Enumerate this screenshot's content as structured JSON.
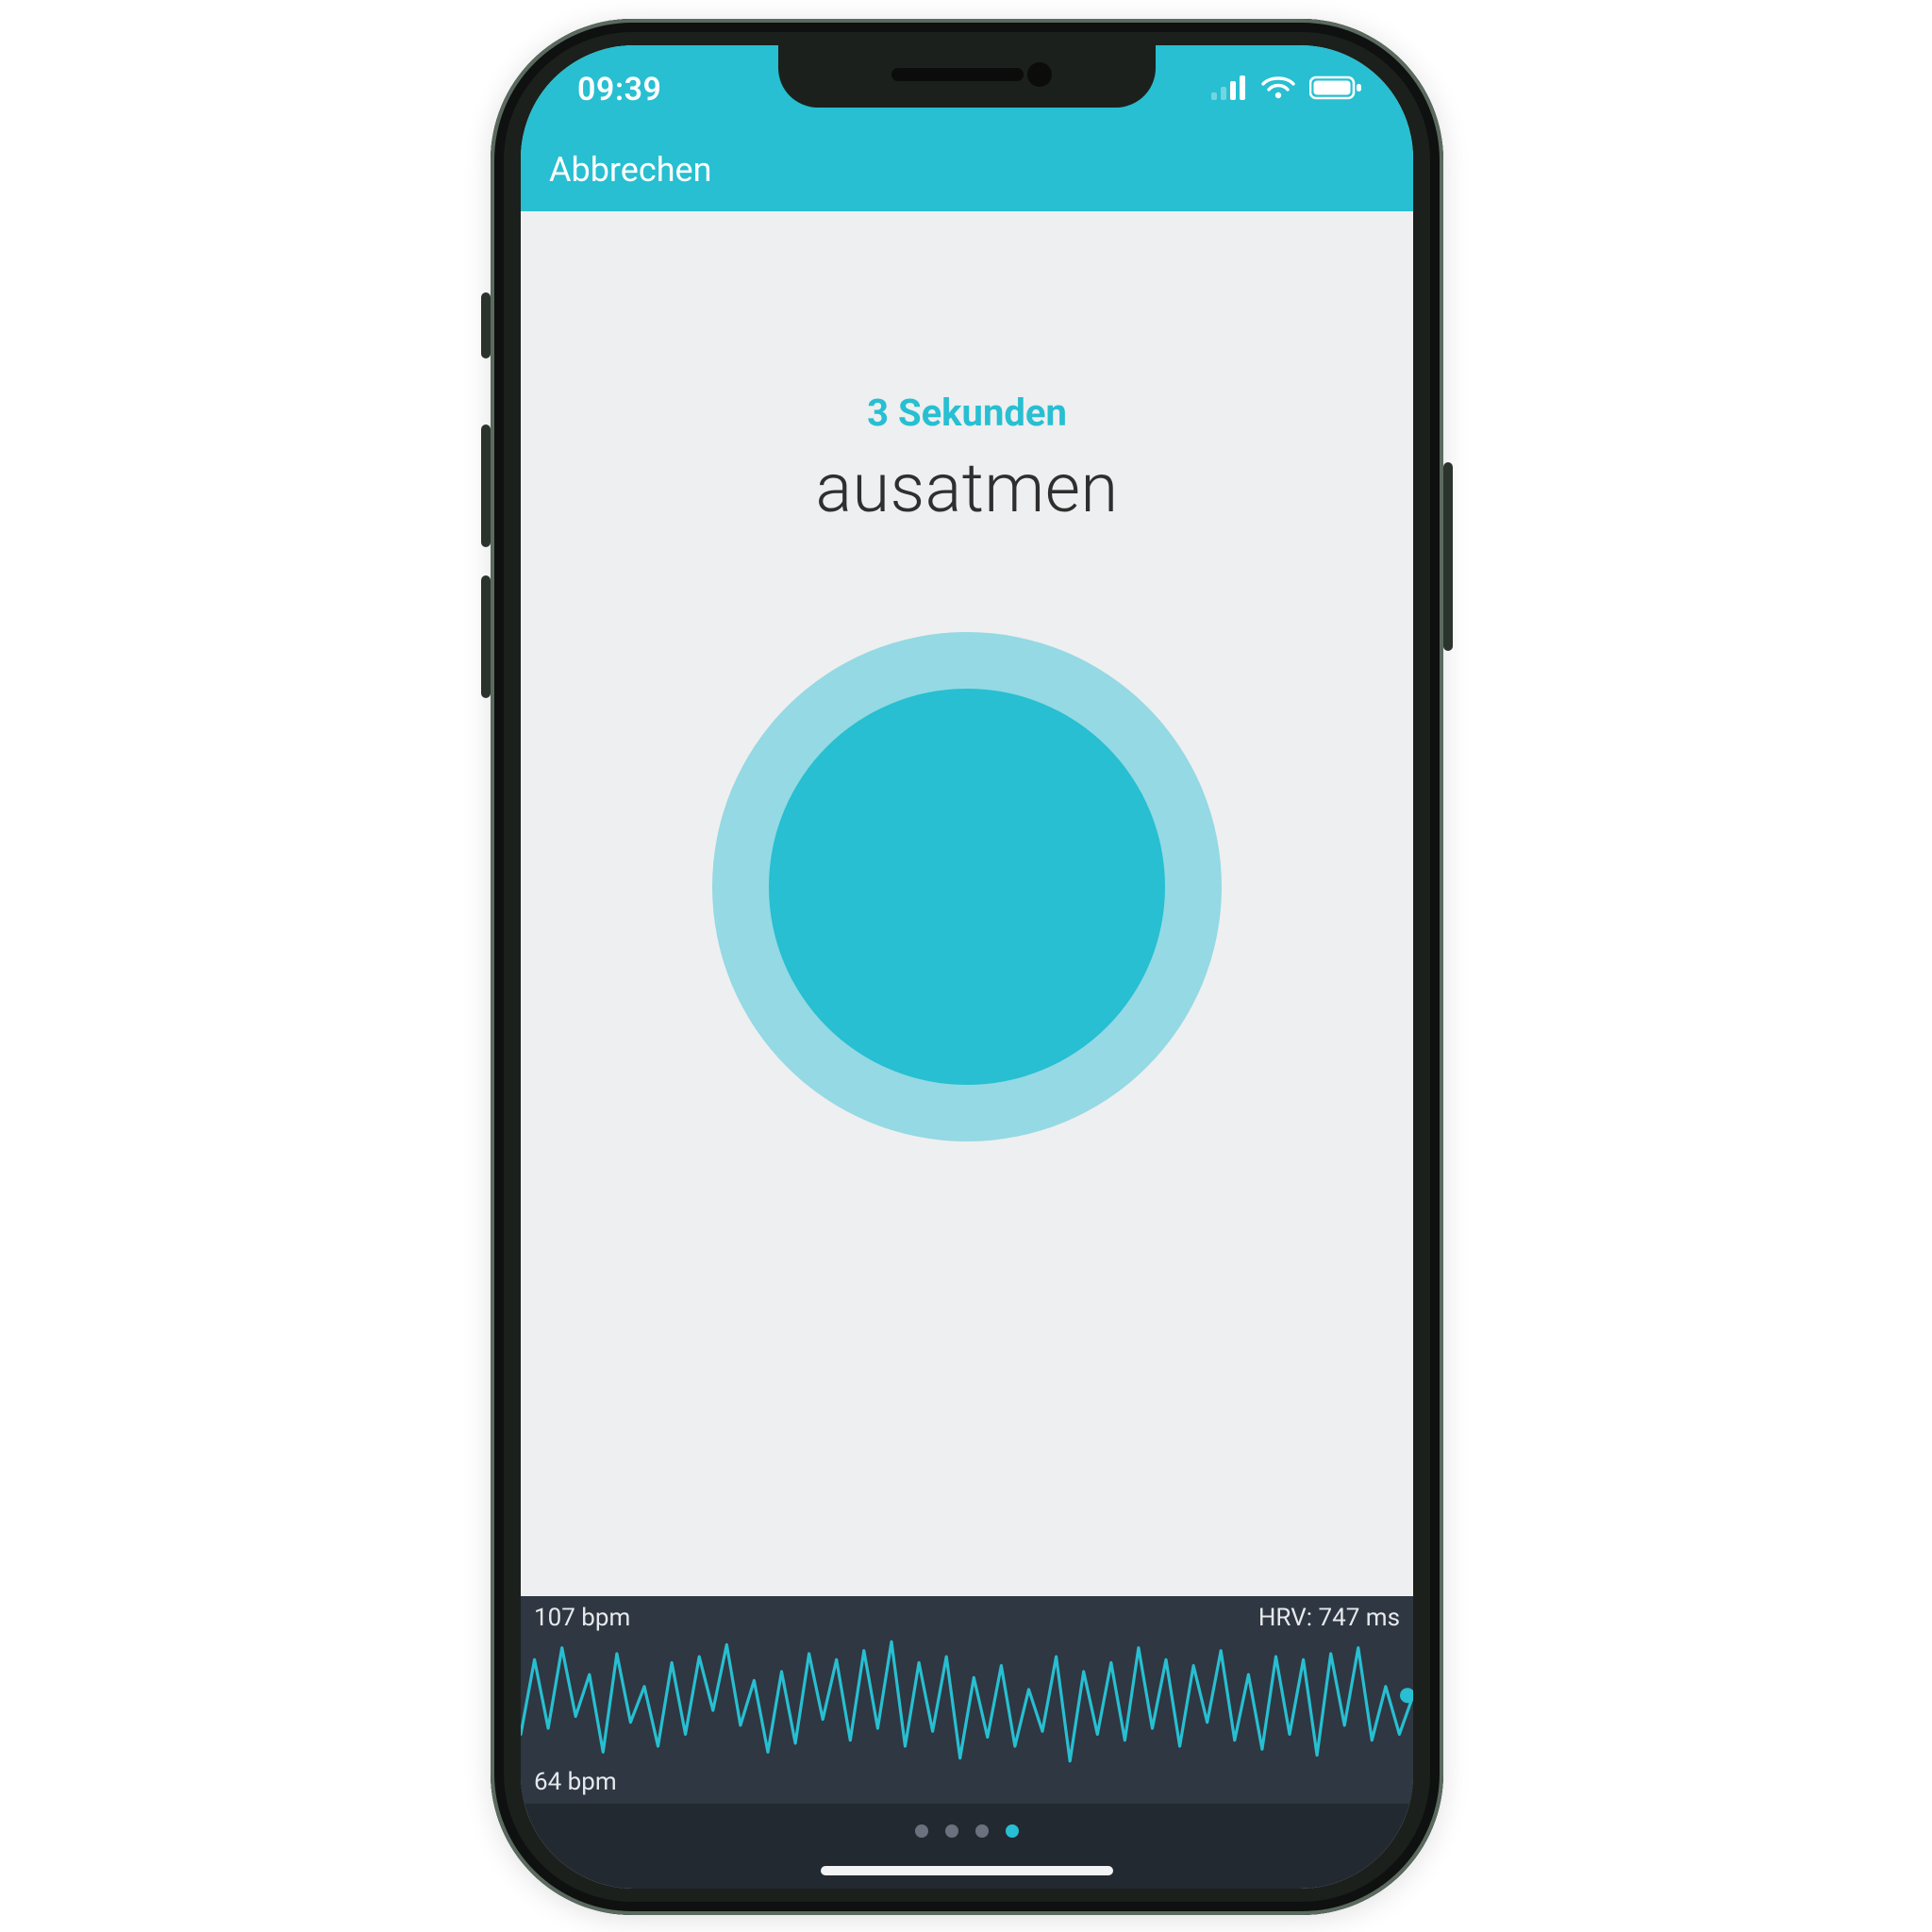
{
  "colors": {
    "accent": "#27bfd1",
    "accent_light": "#94d9e4",
    "panel": "#eeeff0",
    "chart_bg": "#2f3742"
  },
  "status": {
    "time": "09:39"
  },
  "nav": {
    "cancel": "Abbrechen"
  },
  "session": {
    "timer_label": "3 Sekunden",
    "breath_label": "ausatmen"
  },
  "metrics": {
    "bpm_top": "107 bpm",
    "bpm_bottom": "64 bpm",
    "hrv": "HRV: 747 ms"
  },
  "pager": {
    "count": 4,
    "active_index": 3
  },
  "chart_data": {
    "type": "line",
    "title": "Heart rate",
    "xlabel": "",
    "ylabel": "bpm",
    "ylim": [
      64,
      107
    ],
    "series": [
      {
        "name": "bpm",
        "values": [
          74,
          99,
          76,
          103,
          80,
          94,
          68,
          101,
          78,
          90,
          70,
          98,
          74,
          100,
          82,
          104,
          77,
          92,
          68,
          95,
          71,
          101,
          79,
          99,
          72,
          102,
          76,
          105,
          70,
          98,
          75,
          100,
          66,
          93,
          73,
          97,
          70,
          89,
          75,
          100,
          65,
          95,
          74,
          98,
          72,
          103,
          76,
          99,
          70,
          97,
          78,
          102,
          72,
          94,
          69,
          100,
          74,
          99,
          67,
          101,
          77,
          103,
          72,
          90,
          74,
          87
        ]
      }
    ]
  }
}
